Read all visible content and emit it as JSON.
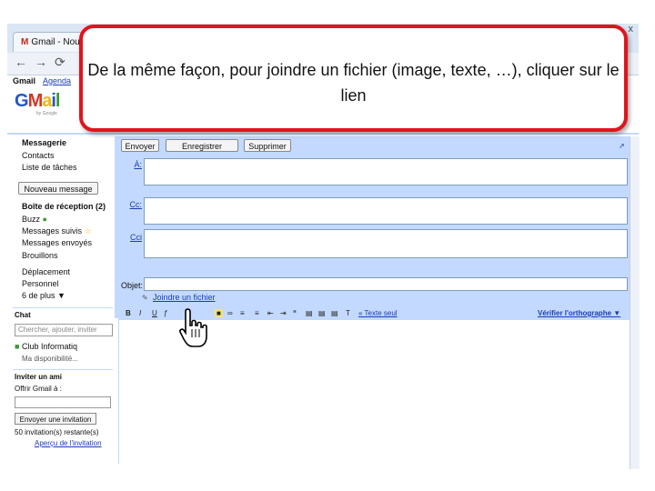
{
  "browser": {
    "tab_title": "Gmail - Nou",
    "close_glyph": "x"
  },
  "topnav": {
    "items": [
      "Gmail",
      "Agenda"
    ]
  },
  "logo": {
    "text": [
      "G",
      "M",
      "a",
      "i",
      "l"
    ],
    "subtitle": "by Google"
  },
  "callout": {
    "text": "De la même façon, pour joindre un fichier (image, texte, …), cliquer sur le lien"
  },
  "sidebar": {
    "primary": [
      "Messagerie",
      "Contacts",
      "Liste de tâches"
    ],
    "compose_button": "Nouveau message",
    "folders": [
      "Boîte de réception (2)",
      "Buzz",
      "Messages suivis",
      "Messages envoyés",
      "Brouillons"
    ],
    "labels": [
      "Déplacement",
      "Personnel",
      "6 de plus ▼"
    ],
    "chat": {
      "title": "Chat",
      "search_placeholder": "Chercher, ajouter, inviter",
      "contact": "Club Informatiq",
      "status": "Ma disponibilité..."
    },
    "invite": {
      "title": "Inviter un ami",
      "offer_label": "Offrir Gmail à :",
      "send_button": "Envoyer une invitation",
      "remaining": "50 invitation(s) restante(s)",
      "preview_link": "Aperçu de l'invitation"
    }
  },
  "compose": {
    "buttons": [
      "Envoyer",
      "Enregistrer",
      "Supprimer"
    ],
    "to_label": "À:",
    "cc_label": "Cc:",
    "bcc_label": "Cci",
    "subject_label": "Objet:",
    "attach_link": "Joindre un fichier",
    "plain_text_link": "« Texte seul",
    "spellcheck_link": "Vérifier l'orthographe ▼"
  }
}
